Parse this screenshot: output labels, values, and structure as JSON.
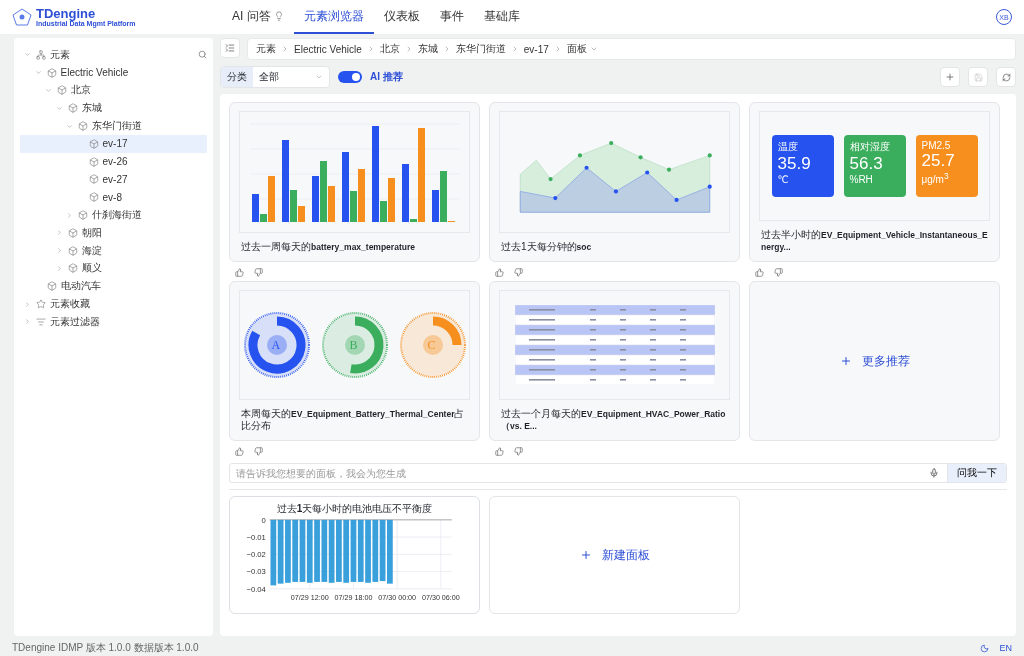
{
  "brand": {
    "name": "TDengine",
    "tagline": "Industrial Data Mgmt Platform"
  },
  "nav": [
    {
      "label": "AI 问答",
      "kind": "ai",
      "selected": false
    },
    {
      "label": "元素浏览器",
      "kind": "plain",
      "selected": true
    },
    {
      "label": "仪表板",
      "kind": "plain",
      "selected": false
    },
    {
      "label": "事件",
      "kind": "plain",
      "selected": false
    },
    {
      "label": "基础库",
      "kind": "plain",
      "selected": false
    }
  ],
  "avatar": "XB",
  "tree": [
    {
      "label": "元素",
      "kind": "root",
      "expanded": true,
      "selected": false,
      "children": [
        {
          "label": "Electric Vehicle",
          "kind": "element",
          "expanded": true,
          "selected": false,
          "children": [
            {
              "label": "北京",
              "kind": "element",
              "expanded": true,
              "selected": false,
              "children": [
                {
                  "label": "东城",
                  "kind": "element",
                  "expanded": true,
                  "selected": false,
                  "children": [
                    {
                      "label": "东华门街道",
                      "kind": "element",
                      "expanded": true,
                      "selected": false,
                      "children": [
                        {
                          "label": "ev-17",
                          "kind": "element",
                          "selected": true
                        },
                        {
                          "label": "ev-26",
                          "kind": "element",
                          "selected": false
                        },
                        {
                          "label": "ev-27",
                          "kind": "element",
                          "selected": false
                        },
                        {
                          "label": "ev-8",
                          "kind": "element",
                          "selected": false
                        }
                      ]
                    },
                    {
                      "label": "什刹海街道",
                      "kind": "element",
                      "expanded": false,
                      "selected": false
                    }
                  ]
                },
                {
                  "label": "朝阳",
                  "kind": "element",
                  "expanded": false,
                  "selected": false
                },
                {
                  "label": "海淀",
                  "kind": "element",
                  "expanded": false,
                  "selected": false
                },
                {
                  "label": "顺义",
                  "kind": "element",
                  "expanded": false,
                  "selected": false
                }
              ]
            }
          ]
        },
        {
          "label": "电动汽车",
          "kind": "element",
          "selected": false
        }
      ]
    },
    {
      "label": "元素收藏",
      "kind": "favorites",
      "expanded": false,
      "selected": false
    },
    {
      "label": "元素过滤器",
      "kind": "filter",
      "expanded": false,
      "selected": false
    }
  ],
  "breadcrumb": [
    "元素",
    "Electric Vehicle",
    "北京",
    "东城",
    "东华门街道",
    "ev-17",
    "面板"
  ],
  "filter": {
    "label": "分类",
    "value": "全部"
  },
  "ai_toggle": {
    "label": "AI 推荐",
    "on": true
  },
  "cards": [
    {
      "kind": "bar_preview",
      "title": "过去一周每天的**battery_max_temperature**"
    },
    {
      "kind": "area_preview",
      "title": "过去1天每分钟的**soc**"
    },
    {
      "kind": "metric_preview",
      "title": "过去半小时的**EV_Equipment_Vehicle_Instantaneous_Energy...**",
      "tiles": [
        {
          "label": "温度",
          "value": "35.9",
          "unit": "℃",
          "color": "#2653f0"
        },
        {
          "label": "相对湿度",
          "value": "56.3",
          "unit": "%RH",
          "color": "#3bae5e"
        },
        {
          "label": "PM2.5",
          "value": "25.7",
          "unit": "μg/m$^{3}$",
          "color": "#f68f1e"
        }
      ]
    },
    {
      "kind": "donut_preview",
      "title": "本周每天的**EV_Equipment_Battery_Thermal_Center**占比分布",
      "donuts": [
        {
          "letter": "A",
          "color": "#2653f0"
        },
        {
          "letter": "B",
          "color": "#3bae5e"
        },
        {
          "letter": "C",
          "color": "#f68f1e"
        }
      ]
    },
    {
      "kind": "table_preview",
      "title": "过去一个月每天的**EV_Equipment_HVAC_Power_Ratio（vs. E...**"
    },
    {
      "kind": "more",
      "title": "更多推荐"
    }
  ],
  "ask": {
    "placeholder": "请告诉我您想要的面板，我会为您生成",
    "button": "问我一下"
  },
  "panels": [
    {
      "kind": "chart",
      "title": "过去**1**天每小时的电池电压不平衡度",
      "chart_data": {
        "type": "bar",
        "categories": [
          null,
          null,
          null,
          null,
          null,
          "07/29 12:00",
          null,
          null,
          null,
          null,
          null,
          "07/29 18:00",
          null,
          null,
          null,
          null,
          null,
          "07/30 00:00",
          null,
          null,
          null,
          null,
          null,
          "07/30 06:00",
          null
        ],
        "series": [
          {
            "color": "#3aa0dc",
            "values": [
              -0.038,
              -0.037,
              -0.0365,
              -0.036,
              -0.036,
              -0.0365,
              -0.036,
              -0.036,
              -0.0365,
              -0.036,
              -0.0365,
              -0.036,
              -0.036,
              -0.0365,
              -0.036,
              -0.0355,
              -0.037,
              null,
              null,
              null,
              null,
              null,
              null,
              null,
              null
            ]
          }
        ],
        "ylim": [
          -0.04,
          0
        ],
        "grid": true,
        "yticks": [
          {
            "value": 0,
            "label": "0"
          },
          {
            "value": -0.01,
            "label": "−0.01"
          },
          {
            "value": -0.02,
            "label": "−0.02"
          },
          {
            "value": -0.03,
            "label": "−0.03"
          },
          {
            "value": -0.04,
            "label": "−0.04"
          }
        ]
      }
    },
    {
      "kind": "new",
      "title": "新建面板"
    }
  ],
  "footer": {
    "version": "TDengine IDMP 版本 1.0.0 数据版本 1.0.0",
    "language": "EN"
  }
}
